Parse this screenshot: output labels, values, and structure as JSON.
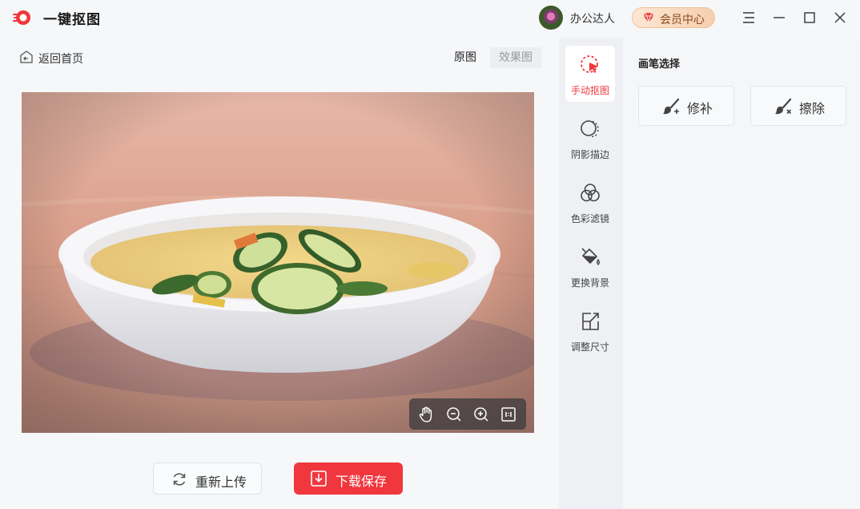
{
  "app": {
    "title": "一键抠图"
  },
  "header": {
    "username": "办公达人",
    "vip_label": "会员中心"
  },
  "nav": {
    "back_label": "返回首页",
    "view_tabs": [
      {
        "label": "原图",
        "active": true
      },
      {
        "label": "效果图",
        "active": false
      }
    ]
  },
  "actions": {
    "reupload_label": "重新上传",
    "save_label": "下载保存"
  },
  "tools": [
    {
      "label": "手动抠图",
      "icon": "manual-cutout-icon",
      "active": true
    },
    {
      "label": "阴影描边",
      "icon": "shadow-outline-icon",
      "active": false
    },
    {
      "label": "色彩滤镜",
      "icon": "color-filter-icon",
      "active": false
    },
    {
      "label": "更换背景",
      "icon": "change-background-icon",
      "active": false
    },
    {
      "label": "调整尺寸",
      "icon": "resize-icon",
      "active": false
    }
  ],
  "brush_panel": {
    "title": "画笔选择",
    "buttons": [
      {
        "label": "修补",
        "icon": "repair-brush-icon"
      },
      {
        "label": "擦除",
        "icon": "erase-brush-icon"
      }
    ]
  },
  "colors": {
    "accent": "#f0373d",
    "vip_text": "#8a4b22"
  }
}
